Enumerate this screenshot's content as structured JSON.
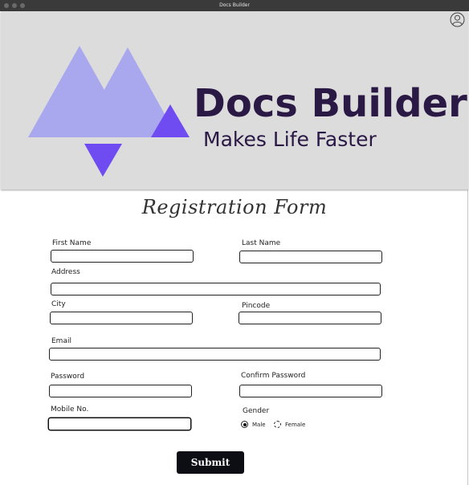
{
  "window": {
    "title": "Docs Builder"
  },
  "header": {
    "brand_name": "Docs Builder",
    "tagline": "Makes Life Faster",
    "account_icon": "user-circle-icon"
  },
  "form": {
    "title": "Registration Form",
    "fields": {
      "first_name": {
        "label": "First Name",
        "value": ""
      },
      "last_name": {
        "label": "Last Name",
        "value": ""
      },
      "address": {
        "label": "Address",
        "value": ""
      },
      "city": {
        "label": "City",
        "value": ""
      },
      "pincode": {
        "label": "Pincode",
        "value": ""
      },
      "email": {
        "label": "Email",
        "value": ""
      },
      "password": {
        "label": "Password",
        "value": ""
      },
      "confirm_password": {
        "label": "Confirm Password",
        "value": ""
      },
      "mobile": {
        "label": "Mobile No.",
        "value": ""
      }
    },
    "gender": {
      "label": "Gender",
      "options": [
        "Male",
        "Female"
      ],
      "selected": "Male"
    },
    "submit_label": "Submit"
  },
  "colors": {
    "logo_light": "#a9a8ef",
    "logo_dark": "#6e4cf2",
    "brand_text": "#2a1845",
    "banner_bg": "#dcdcdc",
    "button_bg": "#0d0d14"
  }
}
